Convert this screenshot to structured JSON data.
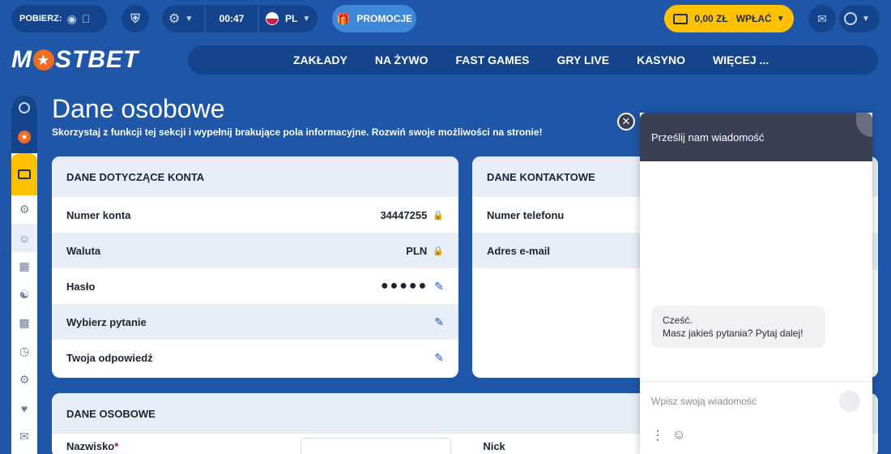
{
  "topbar": {
    "download_label": "POBIERZ:",
    "timer": "00:47",
    "language": "PL",
    "promo_label": "PROMOCJE",
    "balance": "0,00 ZŁ",
    "deposit_label": "WPŁAĆ"
  },
  "logo": {
    "left": "M",
    "right": "STBET"
  },
  "nav": [
    "ZAKŁADY",
    "NA ŻYWO",
    "FAST GAMES",
    "GRY LIVE",
    "KASYNO",
    "WIĘCEJ ..."
  ],
  "page": {
    "title": "Dane osobowe",
    "subtitle": "Skorzystaj z funkcji tej sekcji i wypełnij brakujące pola informacyjne. Rozwiń swoje możliwości na stronie!"
  },
  "account": {
    "heading": "DANE DOTYCZĄCE KONTA",
    "rows": [
      {
        "label": "Numer konta",
        "value": "34447255"
      },
      {
        "label": "Waluta",
        "value": "PLN"
      },
      {
        "label": "Hasło",
        "value": "●●●●●"
      },
      {
        "label": "Wybierz pytanie",
        "value": ""
      },
      {
        "label": "Twoja odpowiedź",
        "value": ""
      }
    ]
  },
  "contact": {
    "heading": "DANE KONTAKTOWE",
    "rows": [
      {
        "label": "Numer telefonu"
      },
      {
        "label": "Adres e-mail"
      }
    ]
  },
  "personal": {
    "heading": "DANE OSOBOWE",
    "surname_label": "Nazwisko",
    "required_mark": "*",
    "nick_label": "Nick"
  },
  "chat": {
    "header": "Prześlij nam wiadomość",
    "greeting_line1": "Cześć.",
    "greeting_line2": "Masz jakieś pytania? Pytaj dalej!",
    "input_placeholder": "Wpisz swoją wiadomość"
  },
  "colors": {
    "background": "#1f56a8",
    "accent_yellow": "#ffc000",
    "brand_orange": "#f36b21",
    "card_row_alt": "#e8eef6"
  }
}
